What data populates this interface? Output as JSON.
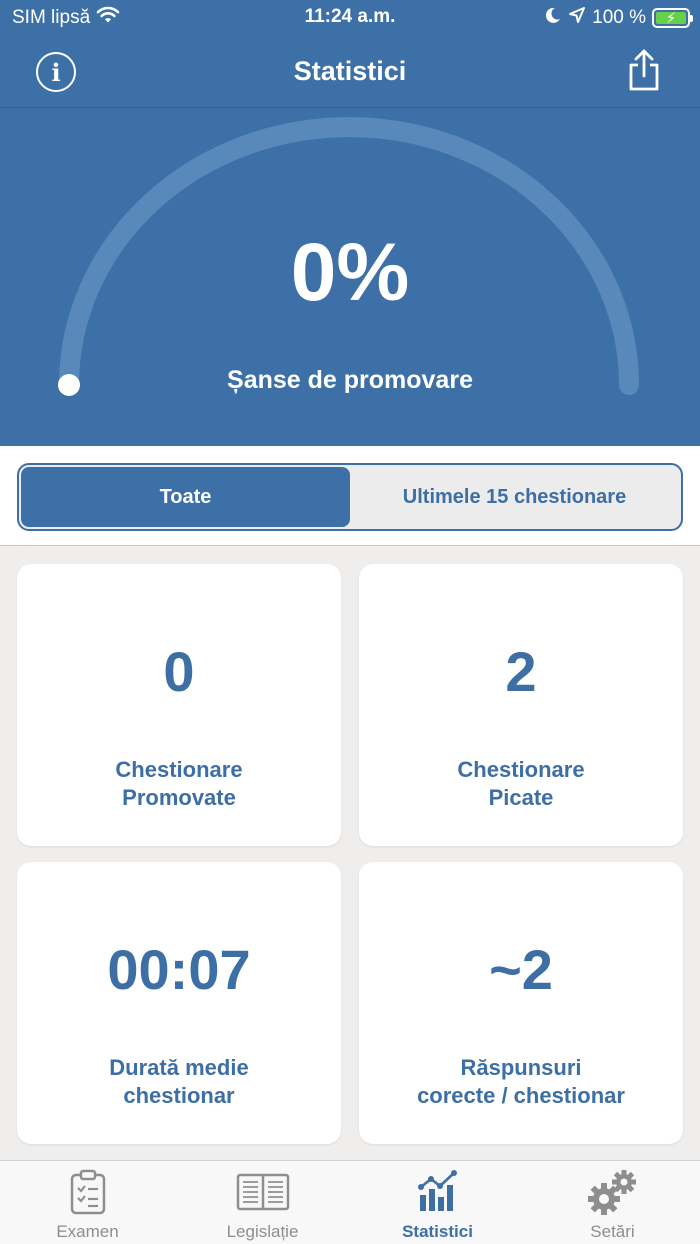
{
  "status_bar": {
    "carrier": "SIM lipsă",
    "time": "11:24 a.m.",
    "battery": "100 %"
  },
  "nav": {
    "title": "Statistici",
    "info_icon": "info-circle-icon",
    "share_icon": "share-icon"
  },
  "gauge": {
    "value": "0%",
    "fraction": 0,
    "label": "Șanse de promovare"
  },
  "filter": {
    "options": [
      "Toate",
      "Ultimele 15 chestionare"
    ],
    "selected": "Toate"
  },
  "stats": [
    {
      "value": "0",
      "label_line1": "Chestionare",
      "label_line2": "Promovate"
    },
    {
      "value": "2",
      "label_line1": "Chestionare",
      "label_line2": "Picate"
    },
    {
      "value": "00:07",
      "label_line1": "Durată medie",
      "label_line2": "chestionar"
    },
    {
      "value": "~2",
      "label_line1": "Răspunsuri",
      "label_line2": "corecte / chestionar"
    }
  ],
  "tabs": [
    {
      "label": "Examen",
      "icon": "clipboard-checklist-icon"
    },
    {
      "label": "Legislație",
      "icon": "open-book-icon"
    },
    {
      "label": "Statistici",
      "icon": "chart-icon"
    },
    {
      "label": "Setări",
      "icon": "gears-icon"
    }
  ],
  "active_tab": "Statistici",
  "colors": {
    "primary": "#3d70a6",
    "text_blue": "#3d6fa5",
    "background": "#efeeec",
    "tab_inactive": "#8e8e8e"
  }
}
